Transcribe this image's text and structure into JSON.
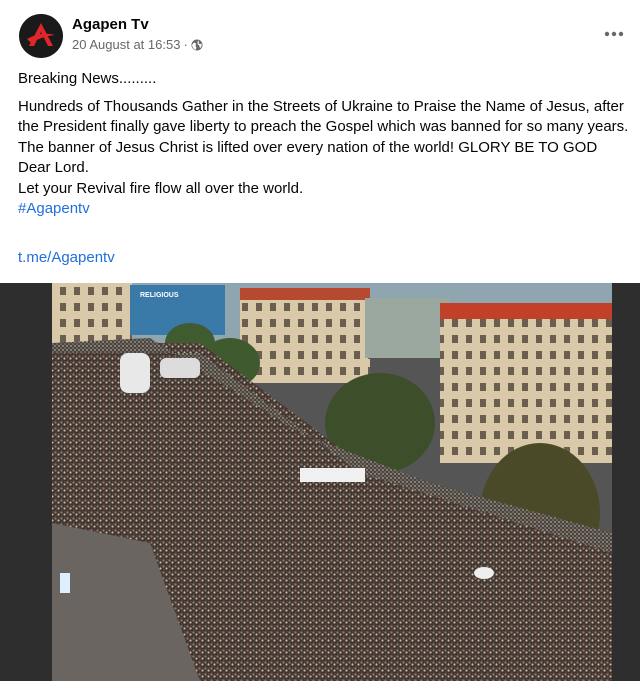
{
  "post": {
    "page_name": "Agapen Tv",
    "timestamp": "20 August at 16:53",
    "separator": "·",
    "privacy_icon": "globe-icon",
    "more_icon": "more-options-icon",
    "lines": [
      "Breaking News.........",
      "Hundreds of Thousands Gather in the Streets of Ukraine to Praise the Name of Jesus, after the President finally gave liberty to preach the Gospel which was banned for so many years. The banner of Jesus Christ is lifted over every nation of the world! GLORY BE TO GOD",
      "Dear Lord.",
      "Let your Revival fire flow all over the world."
    ],
    "hashtag": "#Agapentv",
    "link": "t.me/Agapentv",
    "photo_sign_text": "RELIGIOUS"
  },
  "colors": {
    "link": "#216fdb",
    "meta": "#65676b",
    "avatar_bg": "#1a1a1a",
    "avatar_logo": "#e0262b"
  }
}
